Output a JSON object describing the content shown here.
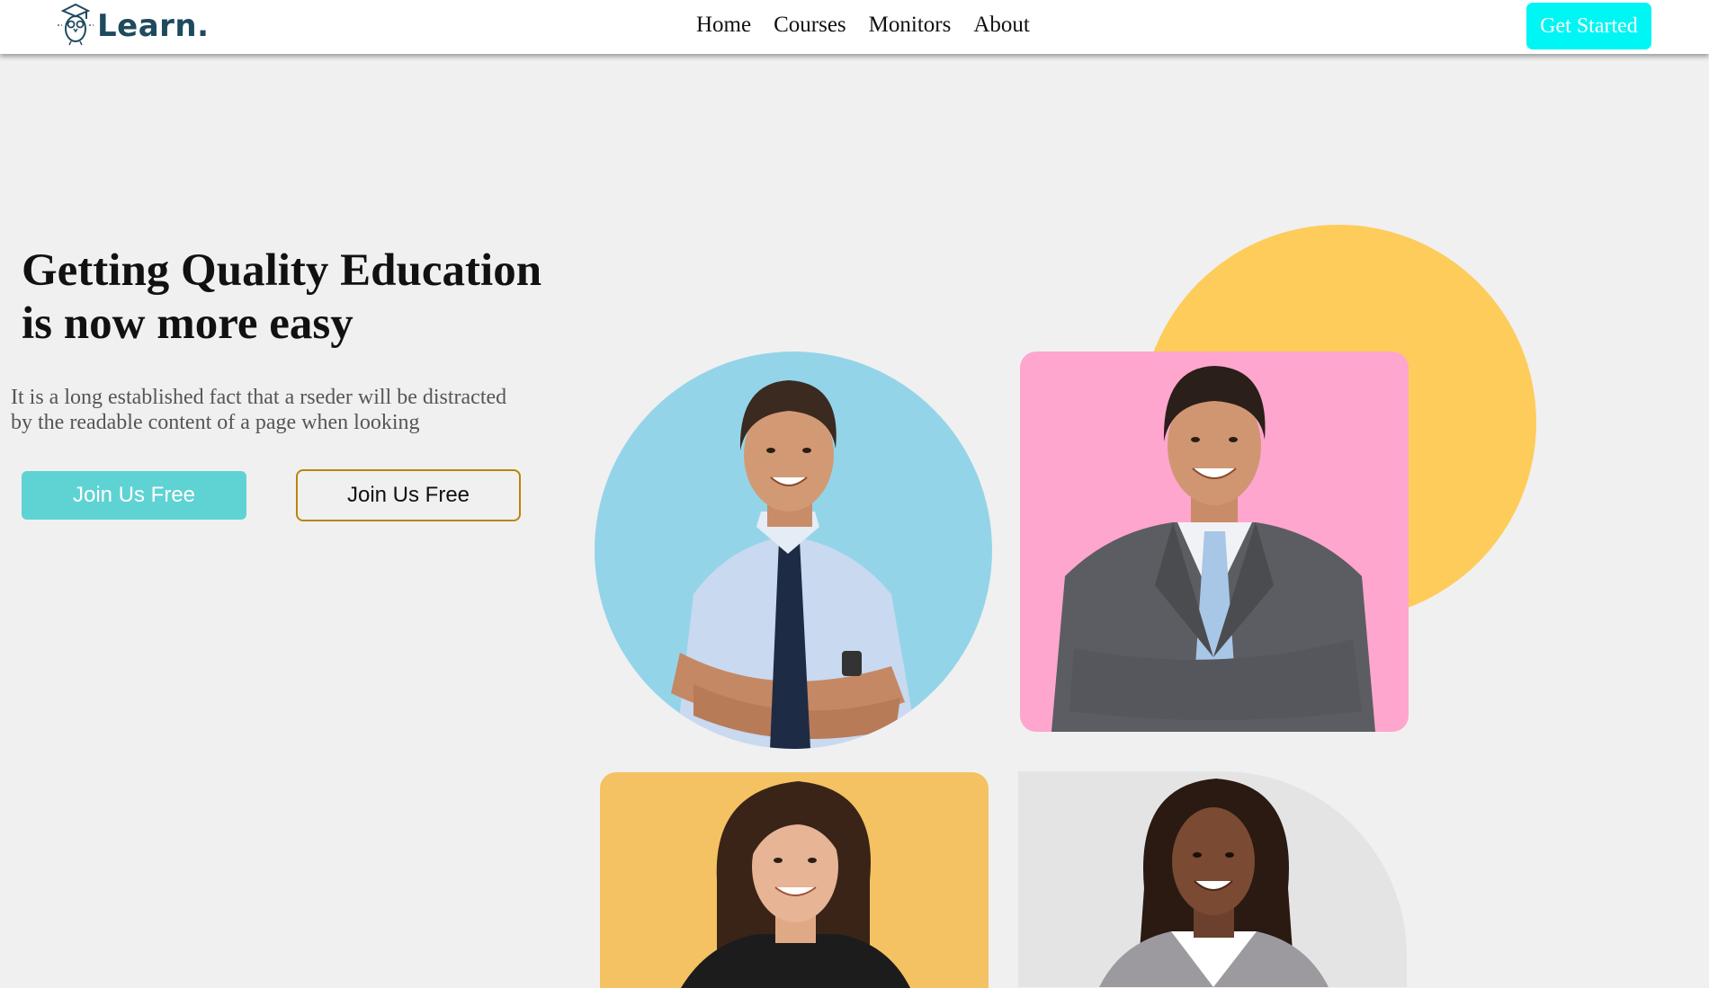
{
  "brand": {
    "name": "Learn.",
    "icon": "graduate-owl-icon"
  },
  "nav": {
    "links": [
      "Home",
      "Courses",
      "Monitors",
      "About"
    ],
    "cta": "Get Started"
  },
  "hero": {
    "title_line1": "Getting Quality Education",
    "title_line2": "is now more easy",
    "text_line1": "It is a long established fact that a rseder will be distracted",
    "text_line2": "by the readable content of a page when looking",
    "primary_button": "Join Us Free",
    "secondary_button": "Join Us Free"
  },
  "colors": {
    "accent_cyan": "#00f5f5",
    "button_teal": "#5fd3d3",
    "outline_gold": "#b8860b",
    "yellow": "#fecc5a",
    "blue": "#94d4e9",
    "pink": "#fea6cd",
    "orange": "#f4c262",
    "grey": "#e4e4e4",
    "logo_text": "#1f4a5e"
  },
  "people": [
    {
      "label": "man-in-blue-shirt-photo"
    },
    {
      "label": "man-in-grey-suit-photo"
    },
    {
      "label": "woman-in-black-blazer-photo"
    },
    {
      "label": "woman-in-white-blouse-photo"
    }
  ]
}
